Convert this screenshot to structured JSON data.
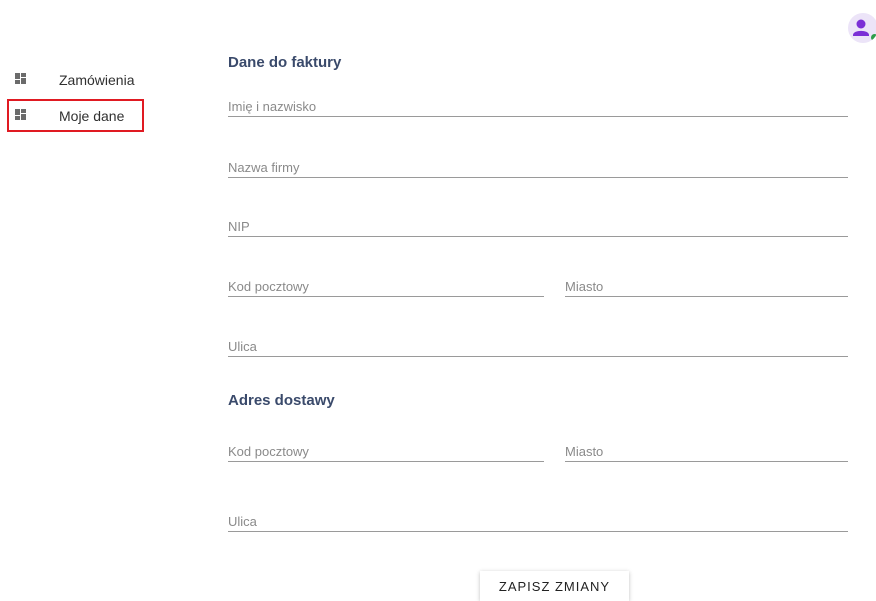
{
  "sidebar": {
    "items": [
      {
        "label": "Zamówienia",
        "icon": "dashboard-icon",
        "active": false
      },
      {
        "label": "Moje dane",
        "icon": "dashboard-icon",
        "active": true
      }
    ]
  },
  "header": {
    "avatar_icon": "user-icon",
    "status_color": "#2e9e4b"
  },
  "invoice": {
    "title": "Dane do faktury",
    "name_placeholder": "Imię i nazwisko",
    "company_placeholder": "Nazwa firmy",
    "nip_placeholder": "NIP",
    "postal_placeholder": "Kod pocztowy",
    "city_placeholder": "Miasto",
    "street_placeholder": "Ulica"
  },
  "shipping": {
    "title": "Adres dostawy",
    "postal_placeholder": "Kod pocztowy",
    "city_placeholder": "Miasto",
    "street_placeholder": "Ulica"
  },
  "actions": {
    "save_label": "ZAPISZ ZMIANY"
  },
  "colors": {
    "title": "#3a4a6b",
    "highlight": "#e01a22",
    "avatar": "#7b2fd6"
  }
}
